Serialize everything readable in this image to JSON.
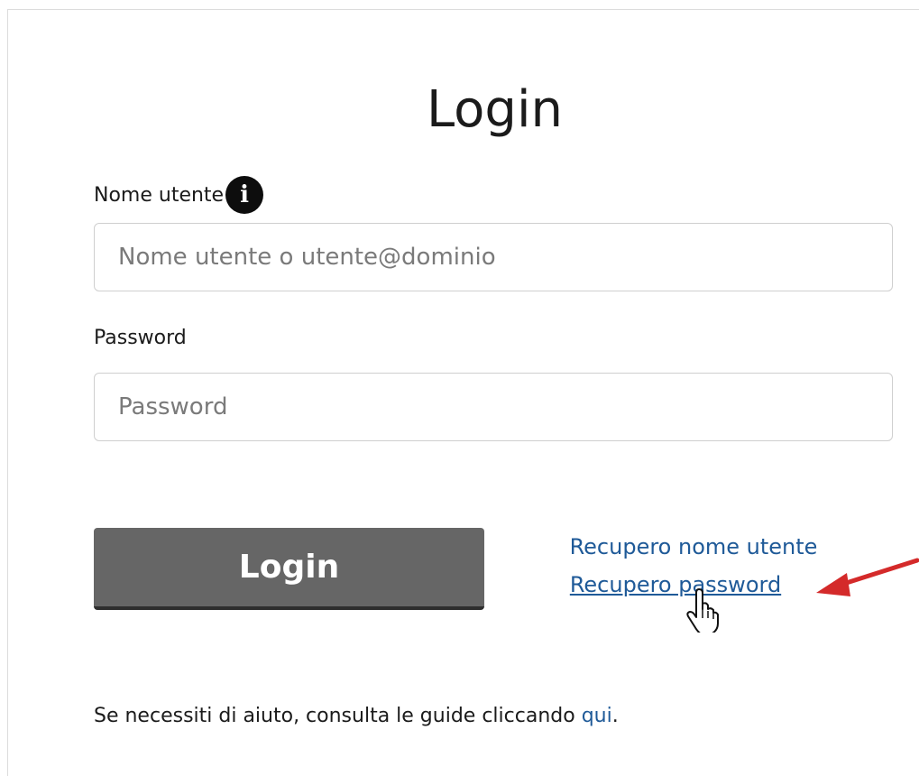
{
  "form": {
    "title": "Login",
    "username_label": "Nome utente",
    "username_placeholder": "Nome utente o utente@dominio",
    "password_label": "Password",
    "password_placeholder": "Password",
    "login_button": "Login"
  },
  "links": {
    "recover_username": "Recupero nome utente",
    "recover_password": "Recupero password"
  },
  "help": {
    "text_prefix": "Se necessiti di aiuto, consulta le guide cliccando ",
    "link_text": "qui",
    "text_suffix": "."
  },
  "icons": {
    "info": "info-icon",
    "annotation_arrow": "arrow-icon",
    "hand_cursor": "hand-cursor-icon"
  },
  "colors": {
    "link": "#1f5a98",
    "button_bg": "#666666",
    "annotation_arrow": "#d42a2a"
  }
}
